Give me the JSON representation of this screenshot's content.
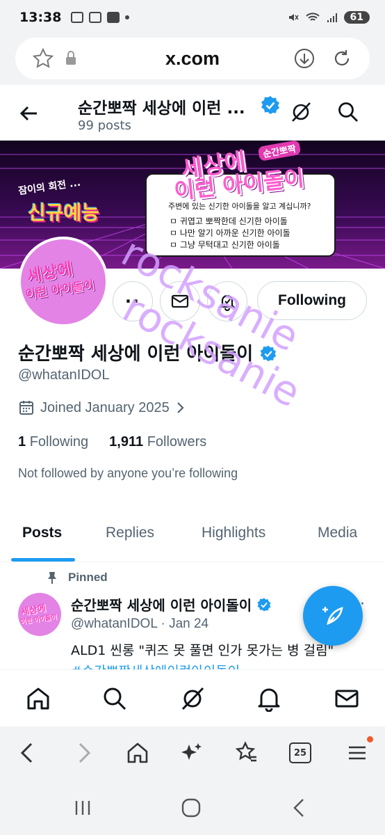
{
  "status_bar": {
    "time": "13:38",
    "battery": "61"
  },
  "browser": {
    "url": "x.com"
  },
  "header": {
    "title": "순간뽀짝 세상에 이런 ...",
    "posts": "99 posts"
  },
  "banner": {
    "top_left_text": "잠이의 회전 ...",
    "badge_text": "신규예능",
    "title_line1": "세상에",
    "title_line2": "이런 아이돌이",
    "title_small": "순간뽀짝",
    "question": "주변에 있는 신기한 아이돌을 알고 계십니까?",
    "list": [
      "ㅁ 귀엽고 뽀짝한데 신기한 아이돌",
      "ㅁ 나만 알기 아까운 신기한 아이돌",
      "ㅁ 그냥 무턱대고 신기한 아이돌"
    ]
  },
  "avatar_text": {
    "line1": "세상에",
    "line2": "이런 아이돌이"
  },
  "profile": {
    "name": "순간뽀짝 세상에 이런 아이돌이",
    "handle": "@whatanIDOL",
    "joined": "Joined January 2025",
    "following_count": "1",
    "following_label": "Following",
    "followers_count": "1,911",
    "followers_label": "Followers",
    "not_followed": "Not followed by anyone you’re following",
    "follow_button": "Following",
    "more_button": "··"
  },
  "tabs": [
    "Posts",
    "Replies",
    "Highlights",
    "Media"
  ],
  "tweet": {
    "pinned_label": "Pinned",
    "name": "순간뽀짝 세상에 이런 아이돌이",
    "meta": "@whatanIDOL · Jan 24",
    "text": "ALD1 씬롱 \"퀴즈 못 풀면 인가 못가는 병 걸림\"",
    "hashtag": "#순간뽀짝세상에이런아이돌이",
    "more": "·"
  },
  "watermark": "rocksanie",
  "icons": {
    "back": "back-arrow-icon",
    "grok": "grok-icon",
    "search": "search-icon",
    "message": "message-icon",
    "notify": "notification-bell-icon",
    "calendar": "calendar-icon",
    "pin": "pin-icon",
    "compose": "compose-feather-icon",
    "home": "home-icon",
    "bell": "bell-icon",
    "mail": "mail-icon",
    "tabs_count": "25"
  },
  "colors": {
    "accent": "#1d9bf0",
    "avatar_bg": "#e383e6",
    "watermark": "#d2a0ff"
  }
}
